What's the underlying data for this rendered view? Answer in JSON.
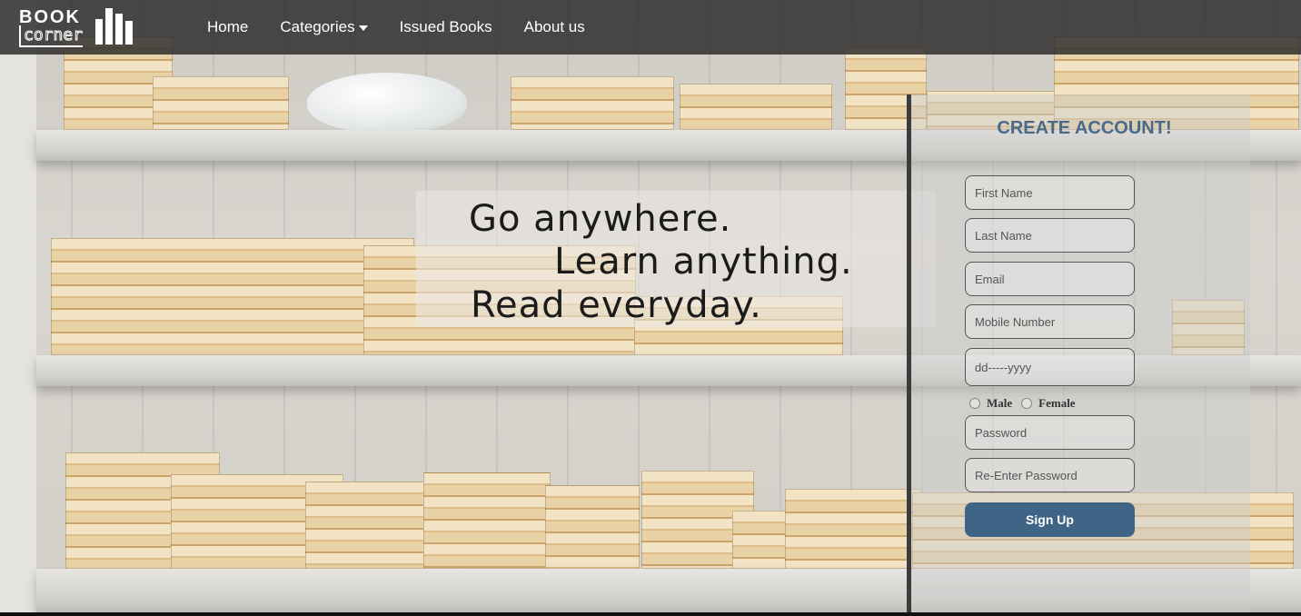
{
  "brand": {
    "logo_top": "BOOK",
    "logo_bottom": "corner"
  },
  "nav": {
    "items": [
      {
        "label": "Home"
      },
      {
        "label": "Categories",
        "has_dropdown": true
      },
      {
        "label": "Issued Books"
      },
      {
        "label": "About us"
      }
    ]
  },
  "hero": {
    "line1": "Go anywhere.",
    "line2": "Learn anything.",
    "line3": "Read everyday."
  },
  "signup": {
    "title": "CREATE ACCOUNT!",
    "first_name_placeholder": "First Name",
    "last_name_placeholder": "Last Name",
    "email_placeholder": "Email",
    "mobile_placeholder": "Mobile Number",
    "dob_placeholder": "dd-----yyyy",
    "gender_options": [
      "Male",
      "Female"
    ],
    "password_placeholder": "Password",
    "reenter_password_placeholder": "Re-Enter Password",
    "submit_label": "Sign Up"
  },
  "colors": {
    "navbar": "#282828",
    "title": "#4a6a8a",
    "button": "#3f6485"
  }
}
